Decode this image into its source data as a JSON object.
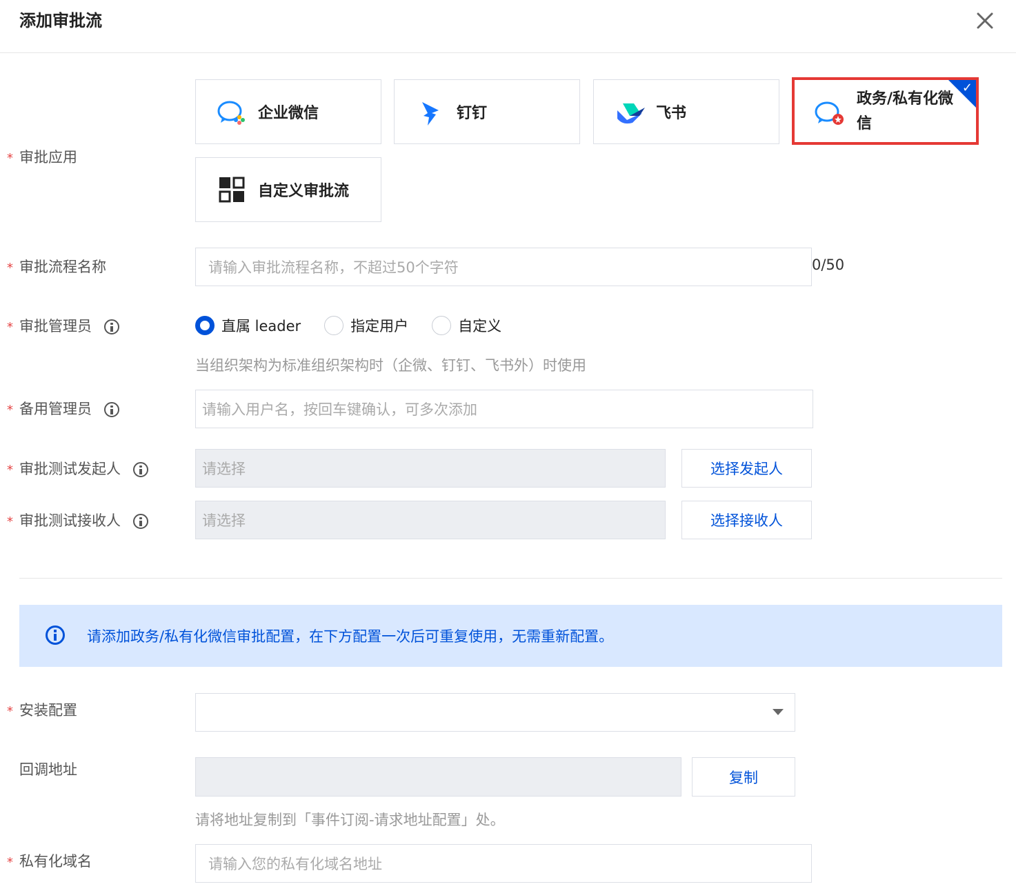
{
  "dialog": {
    "title": "添加审批流"
  },
  "apps": {
    "label": "审批应用",
    "options": [
      {
        "label": "企业微信",
        "icon": "wecom-icon",
        "selected": false
      },
      {
        "label": "钉钉",
        "icon": "dingtalk-icon",
        "selected": false
      },
      {
        "label": "飞书",
        "icon": "feishu-icon",
        "selected": false
      },
      {
        "label": "政务/私有化微信",
        "icon": "gov-wechat-icon",
        "selected": true
      },
      {
        "label": "自定义审批流",
        "icon": "custom-grid-icon",
        "selected": false
      }
    ]
  },
  "flow_name": {
    "label": "审批流程名称",
    "placeholder": "请输入审批流程名称，不超过50个字符",
    "counter": "0/50"
  },
  "admin": {
    "label": "审批管理员",
    "radios": [
      {
        "label": "直属 leader",
        "checked": true
      },
      {
        "label": "指定用户",
        "checked": false
      },
      {
        "label": "自定义",
        "checked": false
      }
    ],
    "hint": "当组织架构为标准组织架构时（企微、钉钉、飞书外）时使用"
  },
  "backup_admin": {
    "label": "备用管理员",
    "placeholder": "请输入用户名，按回车键确认，可多次添加"
  },
  "test_initiator": {
    "label": "审批测试发起人",
    "placeholder": "请选择",
    "button": "选择发起人"
  },
  "test_receiver": {
    "label": "审批测试接收人",
    "placeholder": "请选择",
    "button": "选择接收人"
  },
  "banner": {
    "text": "请添加政务/私有化微信审批配置，在下方配置一次后可重复使用，无需重新配置。"
  },
  "install_config": {
    "label": "安装配置",
    "value": ""
  },
  "callback": {
    "label": "回调地址",
    "value": "",
    "button": "复制",
    "hint": "请将地址复制到「事件订阅-请求地址配置」处。"
  },
  "private_domain": {
    "label": "私有化域名",
    "placeholder": "请输入您的私有化域名地址"
  },
  "colors": {
    "primary": "#0052d9",
    "required": "#e54545",
    "banner_bg": "#d9e8ff",
    "highlight": "#e53935"
  }
}
